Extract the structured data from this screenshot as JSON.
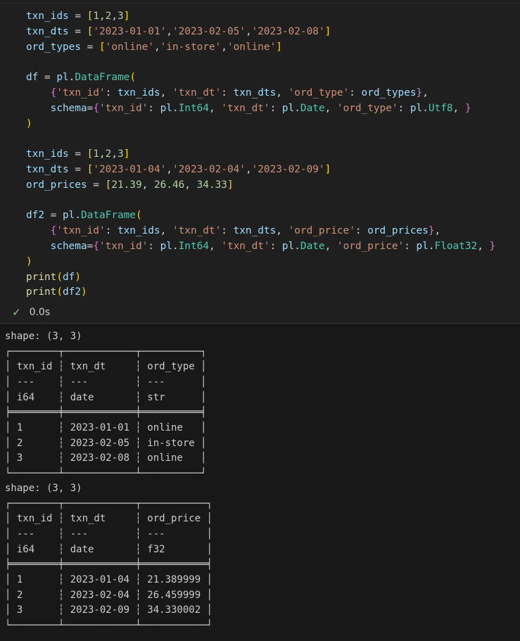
{
  "code": {
    "lines": [
      [
        {
          "t": "txn_ids",
          "k": "v"
        },
        {
          "t": " = ",
          "k": "op"
        },
        {
          "t": "[",
          "k": "b1"
        },
        {
          "t": "1",
          "k": "n"
        },
        {
          "t": ",",
          "k": "op"
        },
        {
          "t": "2",
          "k": "n"
        },
        {
          "t": ",",
          "k": "op"
        },
        {
          "t": "3",
          "k": "n"
        },
        {
          "t": "]",
          "k": "b1"
        }
      ],
      [
        {
          "t": "txn_dts",
          "k": "v"
        },
        {
          "t": " = ",
          "k": "op"
        },
        {
          "t": "[",
          "k": "b1"
        },
        {
          "t": "'2023-01-01'",
          "k": "s"
        },
        {
          "t": ",",
          "k": "op"
        },
        {
          "t": "'2023-02-05'",
          "k": "s"
        },
        {
          "t": ",",
          "k": "op"
        },
        {
          "t": "'2023-02-08'",
          "k": "s"
        },
        {
          "t": "]",
          "k": "b1"
        }
      ],
      [
        {
          "t": "ord_types",
          "k": "v"
        },
        {
          "t": " = ",
          "k": "op"
        },
        {
          "t": "[",
          "k": "b1"
        },
        {
          "t": "'online'",
          "k": "s"
        },
        {
          "t": ",",
          "k": "op"
        },
        {
          "t": "'in-store'",
          "k": "s"
        },
        {
          "t": ",",
          "k": "op"
        },
        {
          "t": "'online'",
          "k": "s"
        },
        {
          "t": "]",
          "k": "b1"
        }
      ],
      [],
      [
        {
          "t": "df",
          "k": "v"
        },
        {
          "t": " = ",
          "k": "op"
        },
        {
          "t": "pl",
          "k": "v"
        },
        {
          "t": ".",
          "k": "op"
        },
        {
          "t": "DataFrame",
          "k": "c"
        },
        {
          "t": "(",
          "k": "b1"
        }
      ],
      [
        {
          "t": "    ",
          "k": "op"
        },
        {
          "t": "{",
          "k": "b2"
        },
        {
          "t": "'txn_id'",
          "k": "s"
        },
        {
          "t": ": ",
          "k": "op"
        },
        {
          "t": "txn_ids",
          "k": "v"
        },
        {
          "t": ", ",
          "k": "op"
        },
        {
          "t": "'txn_dt'",
          "k": "s"
        },
        {
          "t": ": ",
          "k": "op"
        },
        {
          "t": "txn_dts",
          "k": "v"
        },
        {
          "t": ", ",
          "k": "op"
        },
        {
          "t": "'ord_type'",
          "k": "s"
        },
        {
          "t": ": ",
          "k": "op"
        },
        {
          "t": "ord_types",
          "k": "v"
        },
        {
          "t": "}",
          "k": "b2"
        },
        {
          "t": ",",
          "k": "op"
        }
      ],
      [
        {
          "t": "    ",
          "k": "op"
        },
        {
          "t": "schema",
          "k": "v"
        },
        {
          "t": "=",
          "k": "op"
        },
        {
          "t": "{",
          "k": "b2"
        },
        {
          "t": "'txn_id'",
          "k": "s"
        },
        {
          "t": ": ",
          "k": "op"
        },
        {
          "t": "pl",
          "k": "v"
        },
        {
          "t": ".",
          "k": "op"
        },
        {
          "t": "Int64",
          "k": "c"
        },
        {
          "t": ", ",
          "k": "op"
        },
        {
          "t": "'txn_dt'",
          "k": "s"
        },
        {
          "t": ": ",
          "k": "op"
        },
        {
          "t": "pl",
          "k": "v"
        },
        {
          "t": ".",
          "k": "op"
        },
        {
          "t": "Date",
          "k": "c"
        },
        {
          "t": ", ",
          "k": "op"
        },
        {
          "t": "'ord_type'",
          "k": "s"
        },
        {
          "t": ": ",
          "k": "op"
        },
        {
          "t": "pl",
          "k": "v"
        },
        {
          "t": ".",
          "k": "op"
        },
        {
          "t": "Utf8",
          "k": "c"
        },
        {
          "t": ", ",
          "k": "op"
        },
        {
          "t": "}",
          "k": "b2"
        }
      ],
      [
        {
          "t": ")",
          "k": "b1"
        }
      ],
      [],
      [
        {
          "t": "txn_ids",
          "k": "v"
        },
        {
          "t": " = ",
          "k": "op"
        },
        {
          "t": "[",
          "k": "b1"
        },
        {
          "t": "1",
          "k": "n"
        },
        {
          "t": ",",
          "k": "op"
        },
        {
          "t": "2",
          "k": "n"
        },
        {
          "t": ",",
          "k": "op"
        },
        {
          "t": "3",
          "k": "n"
        },
        {
          "t": "]",
          "k": "b1"
        }
      ],
      [
        {
          "t": "txn_dts",
          "k": "v"
        },
        {
          "t": " = ",
          "k": "op"
        },
        {
          "t": "[",
          "k": "b1"
        },
        {
          "t": "'2023-01-04'",
          "k": "s"
        },
        {
          "t": ",",
          "k": "op"
        },
        {
          "t": "'2023-02-04'",
          "k": "s"
        },
        {
          "t": ",",
          "k": "op"
        },
        {
          "t": "'2023-02-09'",
          "k": "s"
        },
        {
          "t": "]",
          "k": "b1"
        }
      ],
      [
        {
          "t": "ord_prices",
          "k": "v"
        },
        {
          "t": " = ",
          "k": "op"
        },
        {
          "t": "[",
          "k": "b1"
        },
        {
          "t": "21.39",
          "k": "n"
        },
        {
          "t": ", ",
          "k": "op"
        },
        {
          "t": "26.46",
          "k": "n"
        },
        {
          "t": ", ",
          "k": "op"
        },
        {
          "t": "34.33",
          "k": "n"
        },
        {
          "t": "]",
          "k": "b1"
        }
      ],
      [],
      [
        {
          "t": "df2",
          "k": "v"
        },
        {
          "t": " = ",
          "k": "op"
        },
        {
          "t": "pl",
          "k": "v"
        },
        {
          "t": ".",
          "k": "op"
        },
        {
          "t": "DataFrame",
          "k": "c"
        },
        {
          "t": "(",
          "k": "b1"
        }
      ],
      [
        {
          "t": "    ",
          "k": "op"
        },
        {
          "t": "{",
          "k": "b2"
        },
        {
          "t": "'txn_id'",
          "k": "s"
        },
        {
          "t": ": ",
          "k": "op"
        },
        {
          "t": "txn_ids",
          "k": "v"
        },
        {
          "t": ", ",
          "k": "op"
        },
        {
          "t": "'txn_dt'",
          "k": "s"
        },
        {
          "t": ": ",
          "k": "op"
        },
        {
          "t": "txn_dts",
          "k": "v"
        },
        {
          "t": ", ",
          "k": "op"
        },
        {
          "t": "'ord_price'",
          "k": "s"
        },
        {
          "t": ": ",
          "k": "op"
        },
        {
          "t": "ord_prices",
          "k": "v"
        },
        {
          "t": "}",
          "k": "b2"
        },
        {
          "t": ",",
          "k": "op"
        }
      ],
      [
        {
          "t": "    ",
          "k": "op"
        },
        {
          "t": "schema",
          "k": "v"
        },
        {
          "t": "=",
          "k": "op"
        },
        {
          "t": "{",
          "k": "b2"
        },
        {
          "t": "'txn_id'",
          "k": "s"
        },
        {
          "t": ": ",
          "k": "op"
        },
        {
          "t": "pl",
          "k": "v"
        },
        {
          "t": ".",
          "k": "op"
        },
        {
          "t": "Int64",
          "k": "c"
        },
        {
          "t": ", ",
          "k": "op"
        },
        {
          "t": "'txn_dt'",
          "k": "s"
        },
        {
          "t": ": ",
          "k": "op"
        },
        {
          "t": "pl",
          "k": "v"
        },
        {
          "t": ".",
          "k": "op"
        },
        {
          "t": "Date",
          "k": "c"
        },
        {
          "t": ", ",
          "k": "op"
        },
        {
          "t": "'ord_price'",
          "k": "s"
        },
        {
          "t": ": ",
          "k": "op"
        },
        {
          "t": "pl",
          "k": "v"
        },
        {
          "t": ".",
          "k": "op"
        },
        {
          "t": "Float32",
          "k": "c"
        },
        {
          "t": ", ",
          "k": "op"
        },
        {
          "t": "}",
          "k": "b2"
        }
      ],
      [
        {
          "t": ")",
          "k": "b1"
        }
      ],
      [
        {
          "t": "print",
          "k": "f"
        },
        {
          "t": "(",
          "k": "b1"
        },
        {
          "t": "df",
          "k": "v"
        },
        {
          "t": ")",
          "k": "b1"
        }
      ],
      [
        {
          "t": "print",
          "k": "f"
        },
        {
          "t": "(",
          "k": "b1"
        },
        {
          "t": "df2",
          "k": "v"
        },
        {
          "t": ")",
          "k": "b1"
        }
      ]
    ]
  },
  "status": {
    "check_icon": "✓",
    "duration": "0.0s",
    "success_color": "#89d185"
  },
  "output": {
    "df_text": "shape: (3, 3)\n┌────────┬────────────┬──────────┐\n│ txn_id ┆ txn_dt     ┆ ord_type │\n│ ---    ┆ ---        ┆ ---      │\n│ i64    ┆ date       ┆ str      │\n╞════════╪════════════╪══════════╡\n│ 1      ┆ 2023-01-01 ┆ online   │\n│ 2      ┆ 2023-02-05 ┆ in-store │\n│ 3      ┆ 2023-02-08 ┆ online   │\n└────────┴────────────┴──────────┘",
    "df2_text": "shape: (3, 3)\n┌────────┬────────────┬───────────┐\n│ txn_id ┆ txn_dt     ┆ ord_price │\n│ ---    ┆ ---        ┆ ---       │\n│ i64    ┆ date       ┆ f32       │\n╞════════╪════════════╪═══════════╡\n│ 1      ┆ 2023-01-04 ┆ 21.389999 │\n│ 2      ┆ 2023-02-04 ┆ 26.459999 │\n│ 3      ┆ 2023-02-09 ┆ 34.330002 │\n└────────┴────────────┴───────────┘"
  }
}
